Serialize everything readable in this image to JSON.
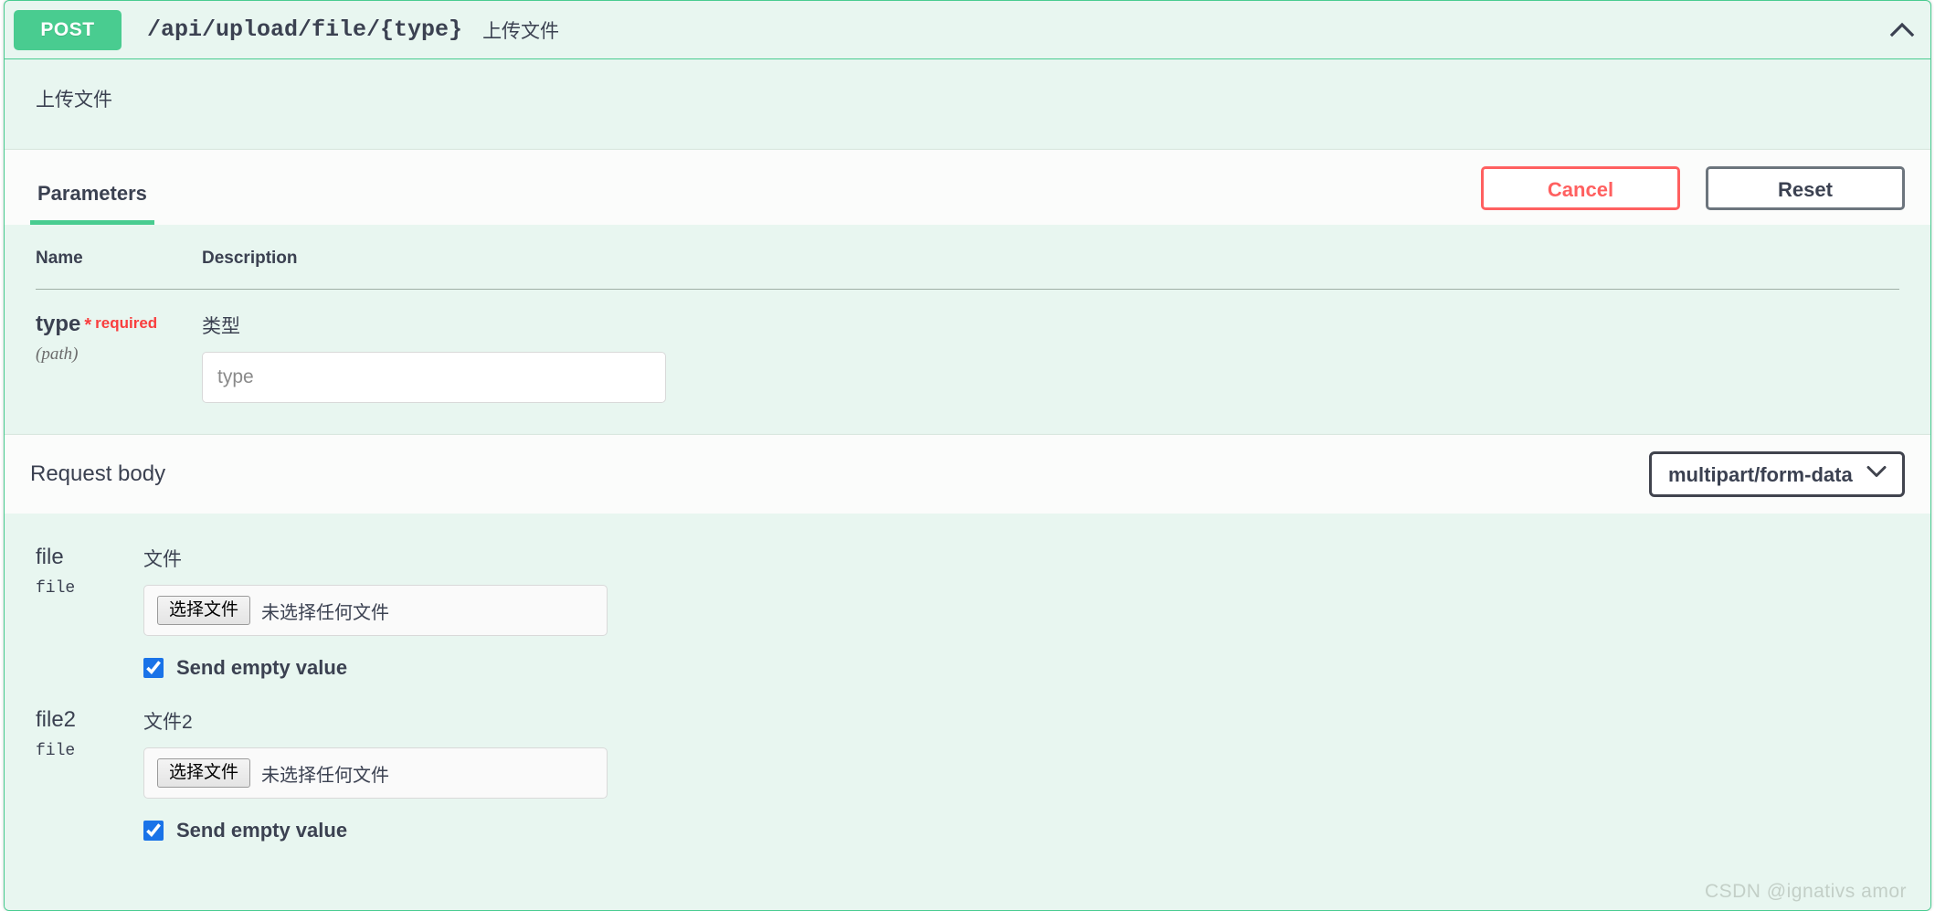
{
  "operation": {
    "method": "POST",
    "path": "/api/upload/file/{type}",
    "summary": "上传文件",
    "description": "上传文件",
    "collapse_icon": "chevron-up-icon",
    "method_color": "#49cc90",
    "border_color": "#49cc90",
    "background_color": "#e8f6f0"
  },
  "section_header": {
    "tabs": [
      {
        "label": "Parameters",
        "active": true
      }
    ],
    "buttons": {
      "cancel_label": "Cancel",
      "reset_label": "Reset",
      "cancel_color": "#ff6060",
      "reset_color": "#6c757d"
    }
  },
  "parameters_table": {
    "columns": [
      "Name",
      "Description"
    ],
    "rows": [
      {
        "name": "type",
        "required_star": "*",
        "required_label": "required",
        "in": "(path)",
        "description": "类型",
        "input_value": "",
        "input_placeholder": "type"
      }
    ]
  },
  "request_body": {
    "title": "Request body",
    "content_type_selected": "multipart/form-data",
    "content_type_options": [
      "multipart/form-data"
    ],
    "chevron_icon": "chevron-down-icon",
    "fields": [
      {
        "name": "file",
        "type": "file",
        "description": "文件",
        "choose_button_label": "选择文件",
        "file_status": "未选择任何文件",
        "send_empty_label": "Send empty value",
        "send_empty_checked": true
      },
      {
        "name": "file2",
        "type": "file",
        "description": "文件2",
        "choose_button_label": "选择文件",
        "file_status": "未选择任何文件",
        "send_empty_label": "Send empty value",
        "send_empty_checked": true
      }
    ]
  },
  "watermark": {
    "text": "CSDN @ignativs  amor"
  }
}
